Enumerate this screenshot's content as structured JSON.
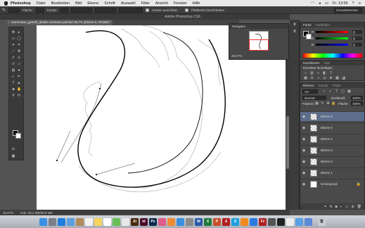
{
  "menubar": {
    "app": "Photoshop",
    "items": [
      "Datei",
      "Bearbeiten",
      "Bild",
      "Ebene",
      "Schrift",
      "Auswahl",
      "Filter",
      "Ansicht",
      "Fenster",
      "Hilfe"
    ],
    "clock": "Fr. 13:56"
  },
  "options": {
    "fill_label": "Fläche:",
    "contour_label": "Kontur:",
    "align_edges": "Kanten ausrichten",
    "constrain_path": "Pfadbreite beschränken",
    "workspace": "Grundelemente"
  },
  "window_title": "Adobe Photoshop CS6",
  "document_tab": "meermann_geschl_details-zeichnen.psd bei 36,7% (Ebene 6, RGB/8) *",
  "navigator": {
    "title": "Navigator",
    "zoom": "36,67%"
  },
  "status": {
    "zoom": "36,67%",
    "doc": "Dok: 26,4 MB/69,9 MB"
  },
  "color_panel": {
    "tabs": [
      "Farbe",
      "Farbfelder"
    ],
    "channels": [
      {
        "label": "R",
        "value": "0",
        "gradient": "#ff3030"
      },
      {
        "label": "G",
        "value": "0",
        "gradient": "#30ff30"
      },
      {
        "label": "B",
        "value": "0",
        "gradient": "#3030ff"
      }
    ]
  },
  "adjustments_panel": {
    "tabs": [
      "Korrekturen",
      "Stile"
    ],
    "subtitle": "Korrektur hinzufügen"
  },
  "layers_panel": {
    "tabs": [
      "Ebenen",
      "Kanäle",
      "Pfade"
    ],
    "kind_filter": "Art",
    "blend_mode": "Normal",
    "opacity_label": "Deckkraft:",
    "opacity_value": "100%",
    "fix_label": "Fixieren:",
    "fill_label": "Fläche:",
    "fill_value": "100%",
    "layers": [
      {
        "name": "Ebene 6",
        "selected": true,
        "background": false
      },
      {
        "name": "Ebene 5",
        "selected": false,
        "background": false
      },
      {
        "name": "Ebene 4",
        "selected": false,
        "background": false
      },
      {
        "name": "Ebene 3",
        "selected": false,
        "background": false
      },
      {
        "name": "Ebene 2",
        "selected": false,
        "background": false
      },
      {
        "name": "Ebene 1",
        "selected": false,
        "background": false
      },
      {
        "name": "Hintergrund",
        "selected": false,
        "background": true
      }
    ]
  },
  "dock_apps": [
    {
      "name": "finder",
      "color": "#3b8ee6",
      "glyph": ""
    },
    {
      "name": "launchpad",
      "color": "#7a7f8a",
      "glyph": ""
    },
    {
      "name": "safari",
      "color": "#1f7ee0",
      "glyph": ""
    },
    {
      "name": "mail",
      "color": "#5aa0e0",
      "glyph": ""
    },
    {
      "name": "contacts",
      "color": "#b08a5a",
      "glyph": ""
    },
    {
      "name": "calendar",
      "color": "#f2f2f2",
      "glyph": ""
    },
    {
      "name": "notes",
      "color": "#f4d35e",
      "glyph": ""
    },
    {
      "name": "reminders",
      "color": "#ffffff",
      "glyph": ""
    },
    {
      "name": "maps",
      "color": "#6bbf59",
      "glyph": ""
    },
    {
      "name": "photos",
      "color": "#e8e8e8",
      "glyph": ""
    },
    {
      "name": "illustrator",
      "color": "#4a2a0a",
      "glyph": "Ai"
    },
    {
      "name": "indesign",
      "color": "#4a0a2a",
      "glyph": "Id"
    },
    {
      "name": "photoshop",
      "color": "#0a2a4a",
      "glyph": "Ps"
    },
    {
      "name": "itunes",
      "color": "#e05a8a",
      "glyph": ""
    },
    {
      "name": "ibooks",
      "color": "#f08a30",
      "glyph": ""
    },
    {
      "name": "app-store",
      "color": "#3a8ee0",
      "glyph": ""
    },
    {
      "name": "preferences",
      "color": "#8a8a8a",
      "glyph": ""
    },
    {
      "name": "word",
      "color": "#2a5aa8",
      "glyph": "W"
    },
    {
      "name": "excel",
      "color": "#1f7a3a",
      "glyph": "X"
    },
    {
      "name": "powerpoint",
      "color": "#c8502a",
      "glyph": "P"
    },
    {
      "name": "acrobat",
      "color": "#b01e1e",
      "glyph": "A"
    },
    {
      "name": "skype",
      "color": "#1ea0e0",
      "glyph": "S"
    },
    {
      "name": "vlc",
      "color": "#f08a20",
      "glyph": ""
    },
    {
      "name": "dropbox",
      "color": "#2a7ae0",
      "glyph": ""
    },
    {
      "name": "filezilla",
      "color": "#b02020",
      "glyph": "Fz"
    },
    {
      "name": "calculator",
      "color": "#555555",
      "glyph": ""
    },
    {
      "name": "terminal",
      "color": "#222222",
      "glyph": ""
    },
    {
      "name": "textedit",
      "color": "#eeeeee",
      "glyph": ""
    },
    {
      "name": "folder",
      "color": "#5aa0e8",
      "glyph": ""
    },
    {
      "name": "downloads",
      "color": "#5a8ad8",
      "glyph": ""
    }
  ]
}
